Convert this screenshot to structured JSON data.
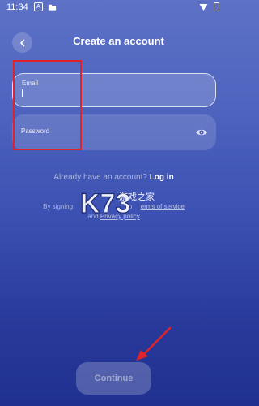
{
  "status_bar": {
    "time": "11:34"
  },
  "header": {
    "title": "Create an account"
  },
  "form": {
    "email_label": "Email",
    "password_label": "Password"
  },
  "login_prompt": {
    "text": "Already have an account?",
    "link": "Log in"
  },
  "terms": {
    "prefix": "By signing",
    "mid": "to",
    "link1": "erms of service",
    "and": "and",
    "link2": "Privacy policy"
  },
  "watermark": {
    "main": "K73",
    "sub": "游戏之家"
  },
  "continue_button": {
    "label": "Continue"
  },
  "colors": {
    "annotation": "#e0222a"
  }
}
